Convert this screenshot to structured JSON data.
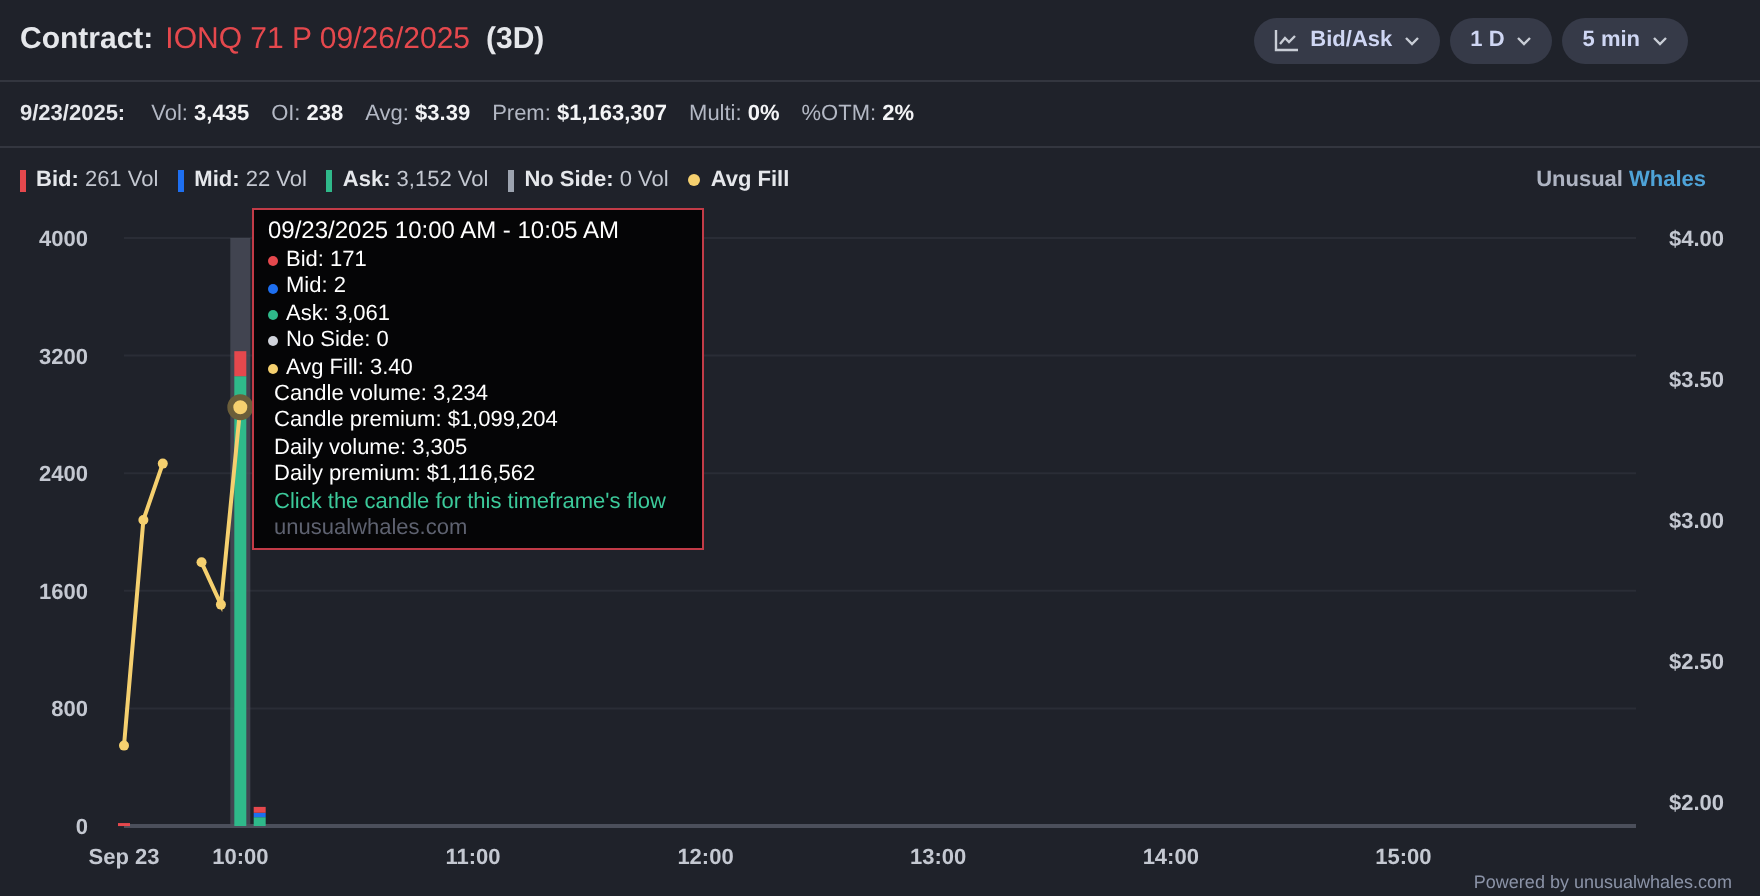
{
  "header": {
    "label": "Contract:",
    "contract": "IONQ 71 P 09/26/2025",
    "dte": "(3D)"
  },
  "controls": [
    {
      "label": "Bid/Ask"
    },
    {
      "label": "1 D"
    },
    {
      "label": "5 min"
    }
  ],
  "stats": {
    "date": "9/23/2025:",
    "items": [
      {
        "label": "Vol:",
        "value": "3,435"
      },
      {
        "label": "OI:",
        "value": "238"
      },
      {
        "label": "Avg:",
        "value": "$3.39"
      },
      {
        "label": "Prem:",
        "value": "$1,163,307"
      },
      {
        "label": "Multi:",
        "value": "0%"
      },
      {
        "label": "%OTM:",
        "value": "2%"
      }
    ]
  },
  "legend": [
    {
      "value": "261 Vol"
    },
    {
      "value": "22 Vol"
    },
    {
      "value": "3,152 Vol"
    },
    {
      "value": "0 Vol"
    }
  ],
  "brand": {
    "first": "Unusual",
    "second": "Whales"
  },
  "chart_data": {
    "type": "bar",
    "stacked": true,
    "grid": true,
    "x": [
      570,
      575,
      580,
      585,
      590,
      595,
      600,
      605
    ],
    "series": [
      {
        "name": "Bid:",
        "color": "#e5484d",
        "values": [
          20,
          null,
          null,
          null,
          null,
          null,
          170,
          40
        ]
      },
      {
        "name": "Mid:",
        "color": "#1e6ff0",
        "values": [
          null,
          null,
          null,
          null,
          null,
          null,
          null,
          30
        ]
      },
      {
        "name": "Ask:",
        "color": "#2fb98a",
        "values": [
          null,
          null,
          null,
          null,
          null,
          null,
          3060,
          60
        ]
      },
      {
        "name": "No Side:",
        "color": "#9ca3af",
        "values": [
          null,
          null,
          null,
          null,
          null,
          null,
          0,
          0
        ]
      },
      {
        "name": "Avg Fill",
        "color": "#f5d06f",
        "type": "line",
        "axis": "y2",
        "marker": "circle",
        "values": [
          2.2,
          3.0,
          3.2,
          null,
          2.85,
          2.7,
          3.4,
          null
        ]
      }
    ],
    "xlim": [
      570,
      960
    ],
    "xticks": [
      {
        "value": 570,
        "label": "Sep 23"
      },
      {
        "value": 600,
        "label": "10:00"
      },
      {
        "value": 660,
        "label": "11:00"
      },
      {
        "value": 720,
        "label": "12:00"
      },
      {
        "value": 780,
        "label": "13:00"
      },
      {
        "value": 840,
        "label": "14:00"
      },
      {
        "value": 900,
        "label": "15:00"
      }
    ],
    "ylim": [
      0,
      4000
    ],
    "yticks": [
      0,
      800,
      1600,
      2400,
      3200,
      4000
    ],
    "y2lim": [
      2,
      4
    ],
    "y2ticks": [
      {
        "value": 2,
        "label": "$2.00"
      },
      {
        "value": 2.5,
        "label": "$2.50"
      },
      {
        "value": 3,
        "label": "$3.00"
      },
      {
        "value": 3.5,
        "label": "$3.50"
      },
      {
        "value": 4,
        "label": "$4.00"
      }
    ]
  },
  "tooltip": {
    "title": "09/23/2025 10:00 AM - 10:05 AM",
    "lines": [
      {
        "kind": "dot",
        "text": "Bid: 171",
        "color": "#e5484d"
      },
      {
        "kind": "dot",
        "text": "Mid: 2",
        "color": "#1e6ff0"
      },
      {
        "kind": "dot",
        "text": "Ask: 3,061",
        "color": "#2fb98a"
      },
      {
        "kind": "dot",
        "text": "No Side: 0",
        "color": "#d0d3da"
      },
      {
        "kind": "dot",
        "text": "Avg Fill: 3.40",
        "color": "#f5d06f"
      },
      {
        "kind": "plain",
        "text": "Candle volume: 3,234"
      },
      {
        "kind": "plain",
        "text": "Candle premium: $1,099,204"
      },
      {
        "kind": "plain",
        "text": "Daily volume: 3,305"
      },
      {
        "kind": "plain",
        "text": "Daily premium: $1,116,562"
      },
      {
        "kind": "link",
        "text": "Click the candle for this timeframe's flow"
      },
      {
        "kind": "footer",
        "text": "unusualwhales.com"
      }
    ]
  },
  "footer": "Powered by unusualwhales.com"
}
